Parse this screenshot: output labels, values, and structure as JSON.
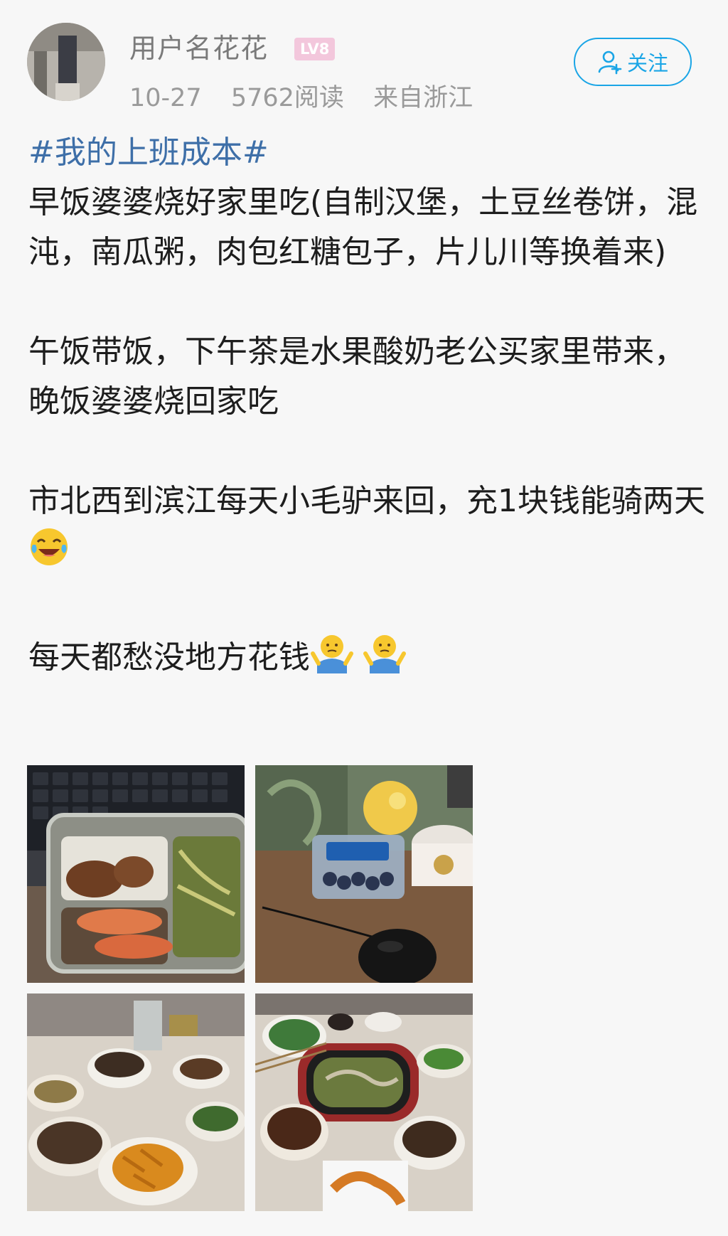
{
  "user": {
    "name": "用户名花花",
    "level": "LV8"
  },
  "meta": {
    "date": "10-27",
    "reads": "5762阅读",
    "location": "来自浙江"
  },
  "follow_button": {
    "label": "关注"
  },
  "post": {
    "hashtag": "#我的上班成本#",
    "para1": "早饭婆婆烧好家里吃(自制汉堡，土豆丝卷饼，混沌，南瓜粥，肉包红糖包子，片儿川等换着来)",
    "para2": "午饭带饭，下午茶是水果酸奶老公买家里带来，晚饭婆婆烧回家吃",
    "para3": "市北西到滨江每天小毛驴来回，充1块钱能骑两天",
    "para4": "每天都愁没地方花钱"
  },
  "photos": [
    {
      "icon": "lunchbox-photo"
    },
    {
      "icon": "fruit-yogurt-photo"
    },
    {
      "icon": "dinner-table-photo"
    },
    {
      "icon": "hotpot-dinner-photo"
    }
  ]
}
